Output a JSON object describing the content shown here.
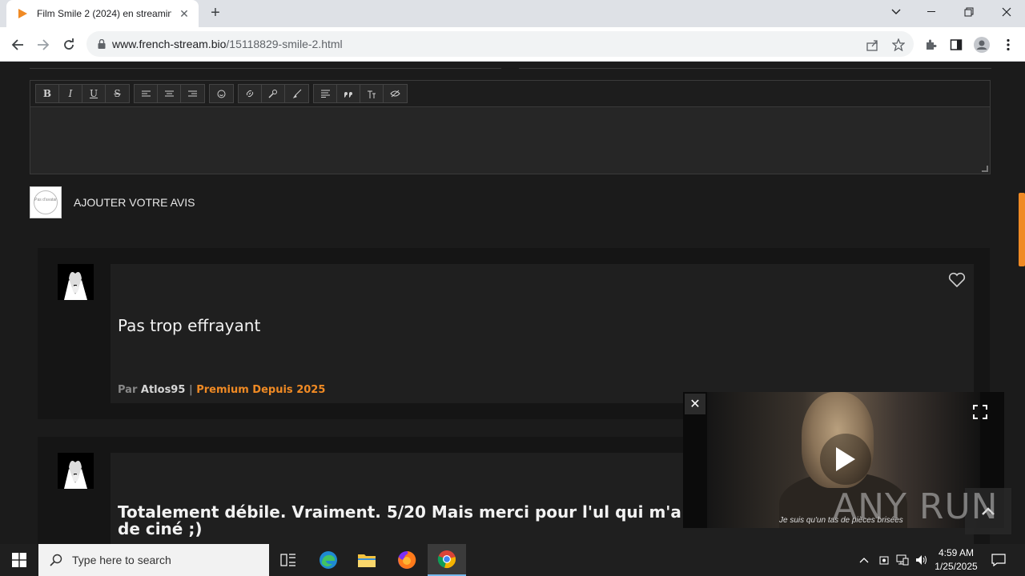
{
  "browser": {
    "tab_title": "Film Smile 2 (2024) en streaming",
    "tab_close": "✕",
    "new_tab": "+",
    "url_host": "www.french-stream.bio",
    "url_path": "/15118829-smile-2.html"
  },
  "editor": {
    "buttons": [
      [
        "B",
        "I",
        "U",
        "S"
      ],
      [
        "align-left",
        "align-center",
        "align-right"
      ],
      [
        "emoji"
      ],
      [
        "link",
        "hide-link",
        "color"
      ],
      [
        "list",
        "quote",
        "text-size",
        "spoiler"
      ]
    ],
    "bold": "B",
    "italic": "I",
    "underline": "U",
    "strike": "S"
  },
  "add_review": {
    "avatar_text": "Pas d'avatar",
    "label": "AJOUTER VOTRE AVIS"
  },
  "reviews": [
    {
      "title": "Pas trop effrayant",
      "meta_prefix": "Par",
      "author": "Atlos95",
      "separator": "|",
      "badge": "Premium Depuis 2025"
    },
    {
      "title": "Totalement débile. Vraiment. 5/20 Mais merci pour l'ul qui m'a",
      "title_line2": "de ciné ;)"
    }
  ],
  "video": {
    "close": "✕",
    "subtitle": "Je suis qu'un tas de pièces brisées"
  },
  "watermark": "ANY RUN",
  "taskbar": {
    "search_placeholder": "Type here to search",
    "time": "4:59 AM",
    "date": "1/25/2025"
  },
  "colors": {
    "accent": "#f08a24",
    "page_bg": "#1b1b1b",
    "card_bg": "#1f1f1f"
  }
}
